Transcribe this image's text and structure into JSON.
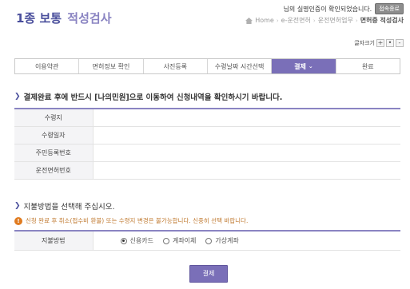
{
  "header": {
    "title_main": "1종 보통",
    "title_sub": "적성검사",
    "login_message": "님의 실명인증이 확인되었습니다.",
    "logout_label": "접속종료"
  },
  "breadcrumb": {
    "items": [
      "Home",
      "e-운전면허",
      "운전면허업무"
    ],
    "current": "면허증 적성검사"
  },
  "font_size": {
    "label": "글자크기",
    "increase": "+",
    "reset": "•",
    "decrease": "-"
  },
  "steps": [
    {
      "label": "이용약관"
    },
    {
      "label": "면허정보 확인"
    },
    {
      "label": "사진등록"
    },
    {
      "label": "수령날짜 시간선택"
    },
    {
      "label": "결제",
      "active": true
    },
    {
      "label": "완료"
    }
  ],
  "notice": "결제완료 후에 반드시 [나의민원]으로 이동하여 신청내역을 확인하시기 바랍니다.",
  "info_rows": [
    {
      "label": "수령지",
      "value": ""
    },
    {
      "label": "수령일자",
      "value": ""
    },
    {
      "label": "주민등록번호",
      "value": ""
    },
    {
      "label": "운전면허번호",
      "value": ""
    }
  ],
  "payment": {
    "section_title": "지불방법을 선택해 주십시오.",
    "warning": "신청 완료 후 취소(접수비 환불) 또는 수령지 변경은 불가능합니다. 신중히 선택 바랍니다.",
    "label": "지불방법",
    "options": [
      {
        "label": "신용카드",
        "selected": true
      },
      {
        "label": "계좌이체",
        "selected": false
      },
      {
        "label": "가상계좌",
        "selected": false
      }
    ],
    "submit_label": "결제"
  },
  "colors": {
    "accent": "#7a6fb8",
    "title": "#4a4f9c",
    "warning": "#e07b20"
  }
}
